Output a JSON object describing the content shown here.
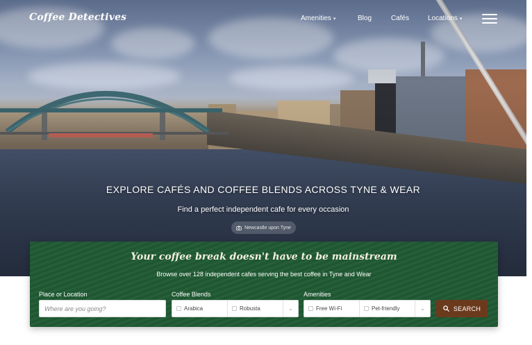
{
  "brand": {
    "logo_text": "Coffee Detectives"
  },
  "nav": {
    "items": [
      {
        "label": "Amenities",
        "has_dropdown": true
      },
      {
        "label": "Blog",
        "has_dropdown": false
      },
      {
        "label": "Cafés",
        "has_dropdown": false
      },
      {
        "label": "Locations",
        "has_dropdown": true
      }
    ],
    "menu_icon": "hamburger-icon"
  },
  "hero": {
    "title": "EXPLORE CAFÉS AND COFFEE BLENDS ACROSS TYNE & WEAR",
    "subtitle": "Find a perfect independent cafe for every occasion",
    "location_chip": "Newcastle upon Tyne",
    "location_icon": "camera-icon"
  },
  "search_panel": {
    "title": "Your coffee break doesn't have to be mainstream",
    "subtitle": "Browse over 128 independent cafes serving the best coffee in Tyne and Wear",
    "place": {
      "label": "Place or Location",
      "placeholder": "Where are you going?",
      "value": ""
    },
    "blends": {
      "label": "Coffee Blends",
      "options": [
        "Arabica",
        "Robusta"
      ]
    },
    "amenities": {
      "label": "Amenities",
      "options": [
        "Free Wi-Fi",
        "Pet-friendly"
      ]
    },
    "search_label": "SEARCH",
    "search_icon": "search-icon"
  },
  "colors": {
    "panel_green": "#1f5a33",
    "search_button": "#6b3a1d",
    "panel_title_cream": "#f4efe2"
  }
}
